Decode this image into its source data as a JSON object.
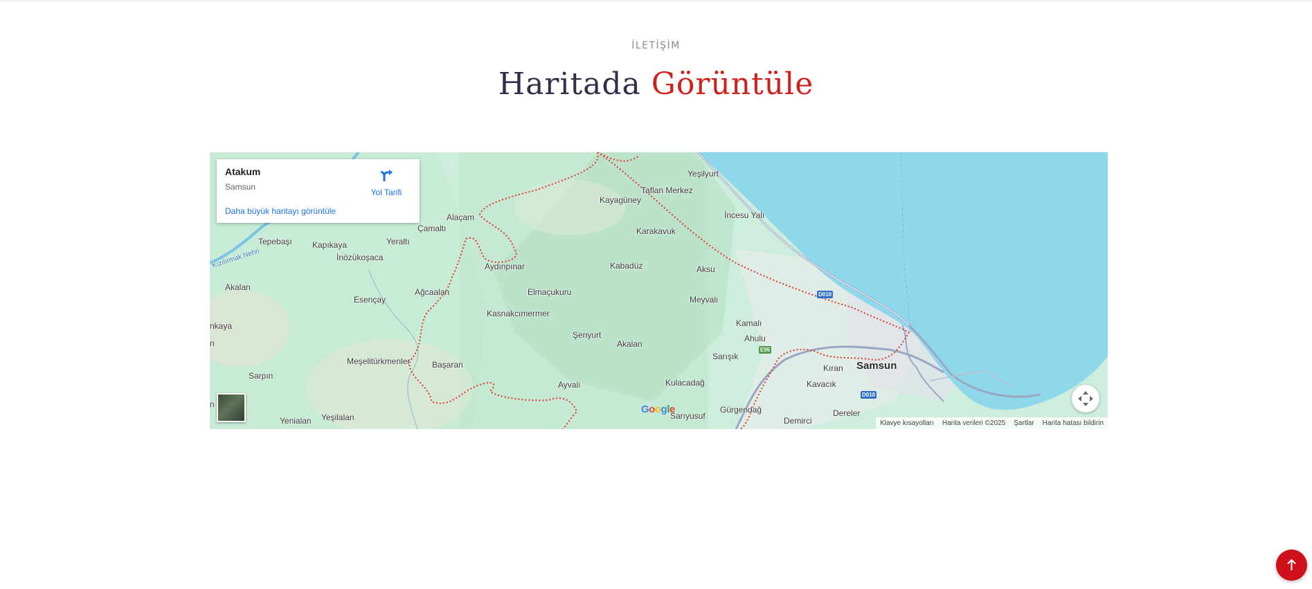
{
  "section": {
    "eyebrow": "İLETİŞİM",
    "heading_part1": "Haritada",
    "heading_part2": "Görüntüle"
  },
  "colors": {
    "accent_red": "#d0201c",
    "heading_dark": "#2f2f4a",
    "map_land": "#cdeedd",
    "map_sea": "#8fd8ec",
    "boundary": "#e3322b",
    "link_blue": "#1a73e8"
  },
  "map": {
    "info_card": {
      "title": "Atakum",
      "subtitle": "Samsun",
      "directions_label": "Yol Tarifi",
      "larger_map_link": "Daha büyük haritayı görüntüle",
      "directions_icon": "directions-icon"
    },
    "places": {
      "yesilyurt": "Yeşilyurt",
      "taflan_merkez": "Taflan Merkez",
      "kayaguney": "Kayagüney",
      "incesu_yali": "İncesu Yalı",
      "alacam": "Alaçam",
      "camalti": "Çamaltı",
      "karakavuk": "Karakavuk",
      "tepebasi": "Tepebaşı",
      "kapikaya": "Kapıkaya",
      "yeralti": "Yeraltı",
      "inozukosaca": "İnözükoşaca",
      "aydinpinar": "Aydınpınar",
      "kabaduz": "Kabadüz",
      "aksu": "Aksu",
      "akalan_west": "Akalan",
      "agcaalan": "Ağcaalan",
      "elmacukuru": "Elmaçukuru",
      "esencay": "Esençay",
      "meyvali": "Meyvalı",
      "kasnakcimermer": "Kasnakcımermer",
      "kamali": "Kamalı",
      "nkaya": "nkaya",
      "senyurt": "Şenyurt",
      "ahulu": "Ahulu",
      "akalan": "Akalan",
      "n_edge": "n",
      "sarisik": "Sarışık",
      "meselitturkmenler": "Meşelitürkmenler",
      "basaran": "Başaran",
      "kiran": "Kıran",
      "samsun": "Samsun",
      "sarpin": "Sarpın",
      "ayvali": "Ayvalı",
      "kulacadag": "Kulacadağ",
      "kavacik": "Kavacık",
      "gurgendag": "Gürgendağ",
      "dereler": "Dereler",
      "sariyusuf": "Sarıyusuf",
      "yenialan": "Yenialan",
      "yesilalan": "Yeşilalan",
      "demirci": "Demirci",
      "n_bottom": "n",
      "river": "Kızılırmak Nehri"
    },
    "road_shields": {
      "d010_a": "D010",
      "e95": "E95",
      "d010_b": "D010"
    },
    "google_logo": "Google",
    "attribution": {
      "shortcuts": "Klavye kısayolları",
      "map_data": "Harita verileri ©2025",
      "terms": "Şartlar",
      "report": "Harita hatası bildirin"
    },
    "layer_icon": "satellite-layer-icon",
    "fullscreen_icon": "fullscreen-icon"
  },
  "scroll_top_icon": "arrow-up-icon"
}
